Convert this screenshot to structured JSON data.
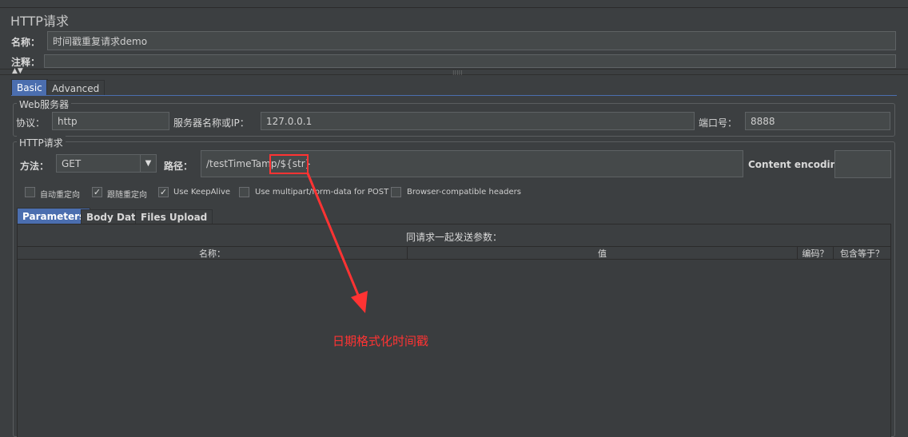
{
  "title": "HTTP请求",
  "name_label": "名称：",
  "name_value": "时间戳重复请求demo",
  "comment_label": "注释：",
  "tabs": [
    "Basic",
    "Advanced"
  ],
  "web_server": {
    "legend": "Web服务器",
    "protocol_label": "协议：",
    "protocol_value": "http",
    "server_label": "服务器名称或IP：",
    "server_value": "127.0.0.1",
    "port_label": "端口号：",
    "port_value": "8888"
  },
  "http_request": {
    "legend": "HTTP请求",
    "method_label": "方法：",
    "method_value": "GET",
    "path_label": "路径：",
    "path_value": "/testTimeTamp/${str}",
    "encoding_label": "Content encoding:"
  },
  "checkboxes": [
    {
      "label": "自动重定向",
      "checked": false
    },
    {
      "label": "跟随重定向",
      "checked": true
    },
    {
      "label": "Use KeepAlive",
      "checked": true
    },
    {
      "label": "Use multipart/form-data for POST",
      "checked": false
    },
    {
      "label": "Browser-compatible headers",
      "checked": false
    }
  ],
  "sub_tabs": [
    "Parameters",
    "Body Data",
    "Files Upload"
  ],
  "params_title": "同请求一起发送参数：",
  "columns": [
    "名称：",
    "值",
    "编码？",
    "包含等于？"
  ],
  "annotation": "日期格式化时间戳",
  "colors": {
    "accent": "#4b6eaf",
    "annotation": "#ff3333"
  }
}
